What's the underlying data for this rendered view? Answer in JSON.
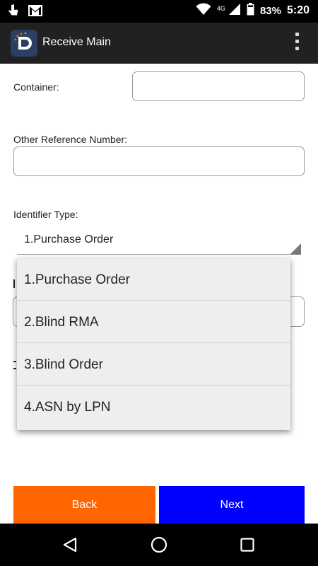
{
  "status_bar": {
    "network": "4G",
    "battery": "83%",
    "time": "5:20"
  },
  "app_bar": {
    "title": "Receive Main"
  },
  "form": {
    "container_label": "Container:",
    "container_value": "",
    "other_reference_label": "Other Reference Number:",
    "other_reference_value": "",
    "identifier_type_label": "Identifier Type:",
    "identifier_type_selected": "1.Purchase Order"
  },
  "dropdown": {
    "options": [
      "1.Purchase Order",
      "2.Blind RMA",
      "3.Blind Order",
      "4.ASN by LPN"
    ]
  },
  "buttons": {
    "back": "Back",
    "next": "Next"
  },
  "colors": {
    "back_button": "#ff6600",
    "next_button": "#0000ff",
    "app_bar": "#212121"
  }
}
